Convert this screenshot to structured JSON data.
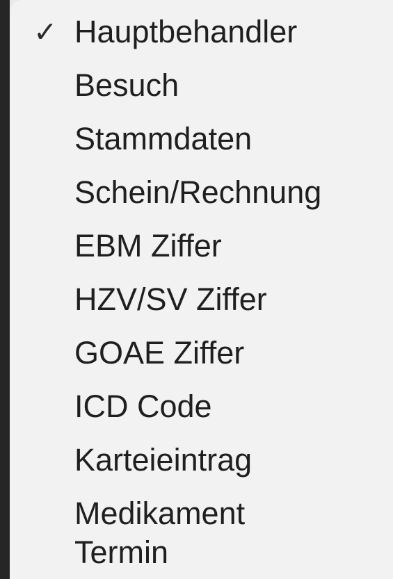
{
  "menu": {
    "items": [
      {
        "label": "Hauptbehandler",
        "checked": true,
        "check_mark": "✓"
      },
      {
        "label": "Besuch",
        "checked": false
      },
      {
        "label": "Stammdaten",
        "checked": false
      },
      {
        "label": "Schein/Rechnung",
        "checked": false
      },
      {
        "label": "EBM Ziffer",
        "checked": false
      },
      {
        "label": "HZV/SV Ziffer",
        "checked": false
      },
      {
        "label": "GOAE Ziffer",
        "checked": false
      },
      {
        "label": "ICD Code",
        "checked": false
      },
      {
        "label": "Karteieintrag",
        "checked": false
      },
      {
        "label": "Medikament",
        "checked": false
      },
      {
        "label": "Termin",
        "checked": false
      }
    ],
    "colors": {
      "background": "#f2f2f2",
      "text": "#1f1f1f",
      "window_edge": "#262626"
    }
  }
}
